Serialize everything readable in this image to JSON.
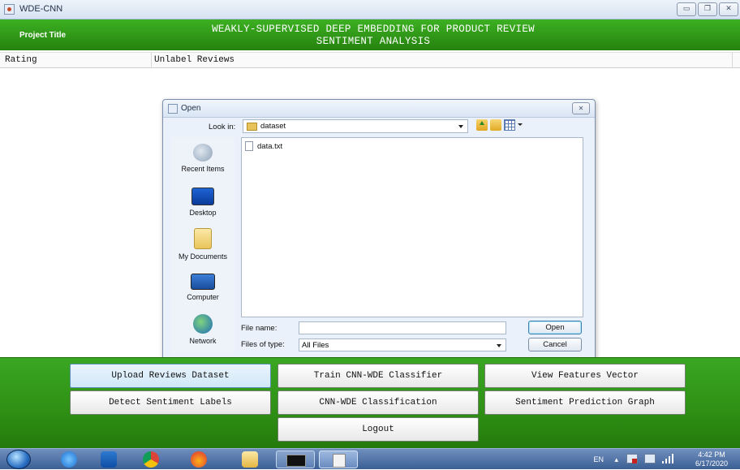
{
  "window": {
    "title": "WDE-CNN",
    "controls": [
      "minimize",
      "maximize",
      "close"
    ]
  },
  "header": {
    "project_label": "Project Title",
    "title_line1": "WEAKLY-SUPERVISED DEEP EMBEDDING FOR PRODUCT REVIEW",
    "title_line2": "SENTIMENT ANALYSIS"
  },
  "table": {
    "columns": [
      "Rating",
      "Unlabel Reviews"
    ]
  },
  "dialog": {
    "title": "Open",
    "look_in_label": "Look in:",
    "look_in_value": "dataset",
    "places": [
      "Recent Items",
      "Desktop",
      "My Documents",
      "Computer",
      "Network"
    ],
    "files": [
      "data.txt"
    ],
    "file_name_label": "File name:",
    "file_name_value": "",
    "files_of_type_label": "Files of type:",
    "files_of_type_value": "All Files",
    "open_label": "Open",
    "cancel_label": "Cancel",
    "close_glyph": "✕"
  },
  "actions": {
    "upload": "Upload Reviews Dataset",
    "train": "Train CNN-WDE Classifier",
    "features": "View Features Vector",
    "detect": "Detect Sentiment Labels",
    "classify": "CNN-WDE Classification",
    "graph": "Sentiment Prediction Graph",
    "logout": "Logout"
  },
  "taskbar": {
    "lang": "EN",
    "caret": "▴",
    "time": "4:42 PM",
    "date": "6/17/2020",
    "apps": [
      "start-orb",
      "internet-explorer",
      "outlook",
      "chrome",
      "firefox",
      "file-explorer",
      "command-prompt",
      "java"
    ]
  }
}
